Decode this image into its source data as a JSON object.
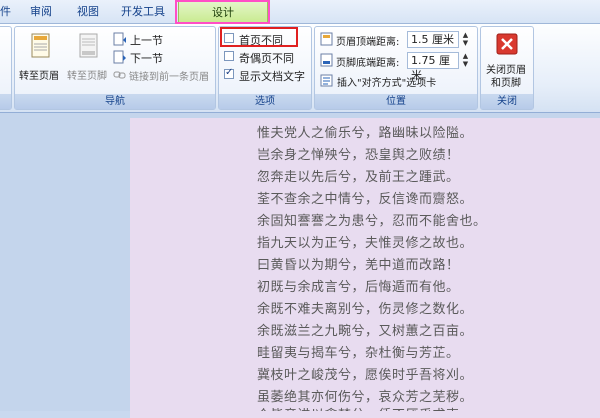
{
  "tabs": [
    {
      "label": "件"
    },
    {
      "label": "审阅"
    },
    {
      "label": "视图"
    },
    {
      "label": "开发工具"
    },
    {
      "label": "设计"
    }
  ],
  "navigation": {
    "goto_header": "转至页眉",
    "goto_footer": "转至页脚",
    "prev_section": "上一节",
    "next_section": "下一节",
    "link_previous": "链接到前一条页眉",
    "label": "导航"
  },
  "options": {
    "different_first": "首页不同",
    "different_odd_even": "奇偶页不同",
    "show_doc_text": "显示文档文字",
    "label": "选项",
    "different_first_checked": false,
    "different_odd_even_checked": false,
    "show_doc_text_checked": true
  },
  "position": {
    "header_top_label": "页眉顶端距离:",
    "header_top_value": "1.5 厘米",
    "footer_bottom_label": "页脚底端距离:",
    "footer_bottom_value": "1.75 厘米",
    "insert_align_tab": "插入\"对齐方式\"选项卡",
    "label": "位置"
  },
  "close": {
    "close_line1": "关闭页眉",
    "close_line2": "和页脚",
    "label": "关闭"
  },
  "document_lines": [
    "惟夫党人之偷乐兮，路幽昧以险隘。",
    "岂余身之惮殃兮，恐皇舆之败绩！",
    "忽奔走以先后兮，及前王之踵武。",
    "荃不查余之中情兮，反信谗而齌怒。",
    "余固知謇謇之为患兮，忍而不能舍也。",
    "指九天以为正兮，夫惟灵修之故也。",
    "曰黄昏以为期兮，羌中道而改路！",
    "初既与余成言兮，后悔遁而有他。",
    "余既不难夫离别兮，伤灵修之数化。",
    "余既滋兰之九畹兮，又树蕙之百亩。",
    "畦留夷与揭车兮，杂杜衡与芳芷。",
    "冀枝叶之峻茂兮，愿俟时乎吾将刈。",
    "虽萎绝其亦何伤兮，哀众芳之芜秽。",
    "众皆竞进以贪婪兮，凭不厌乎求索。"
  ]
}
